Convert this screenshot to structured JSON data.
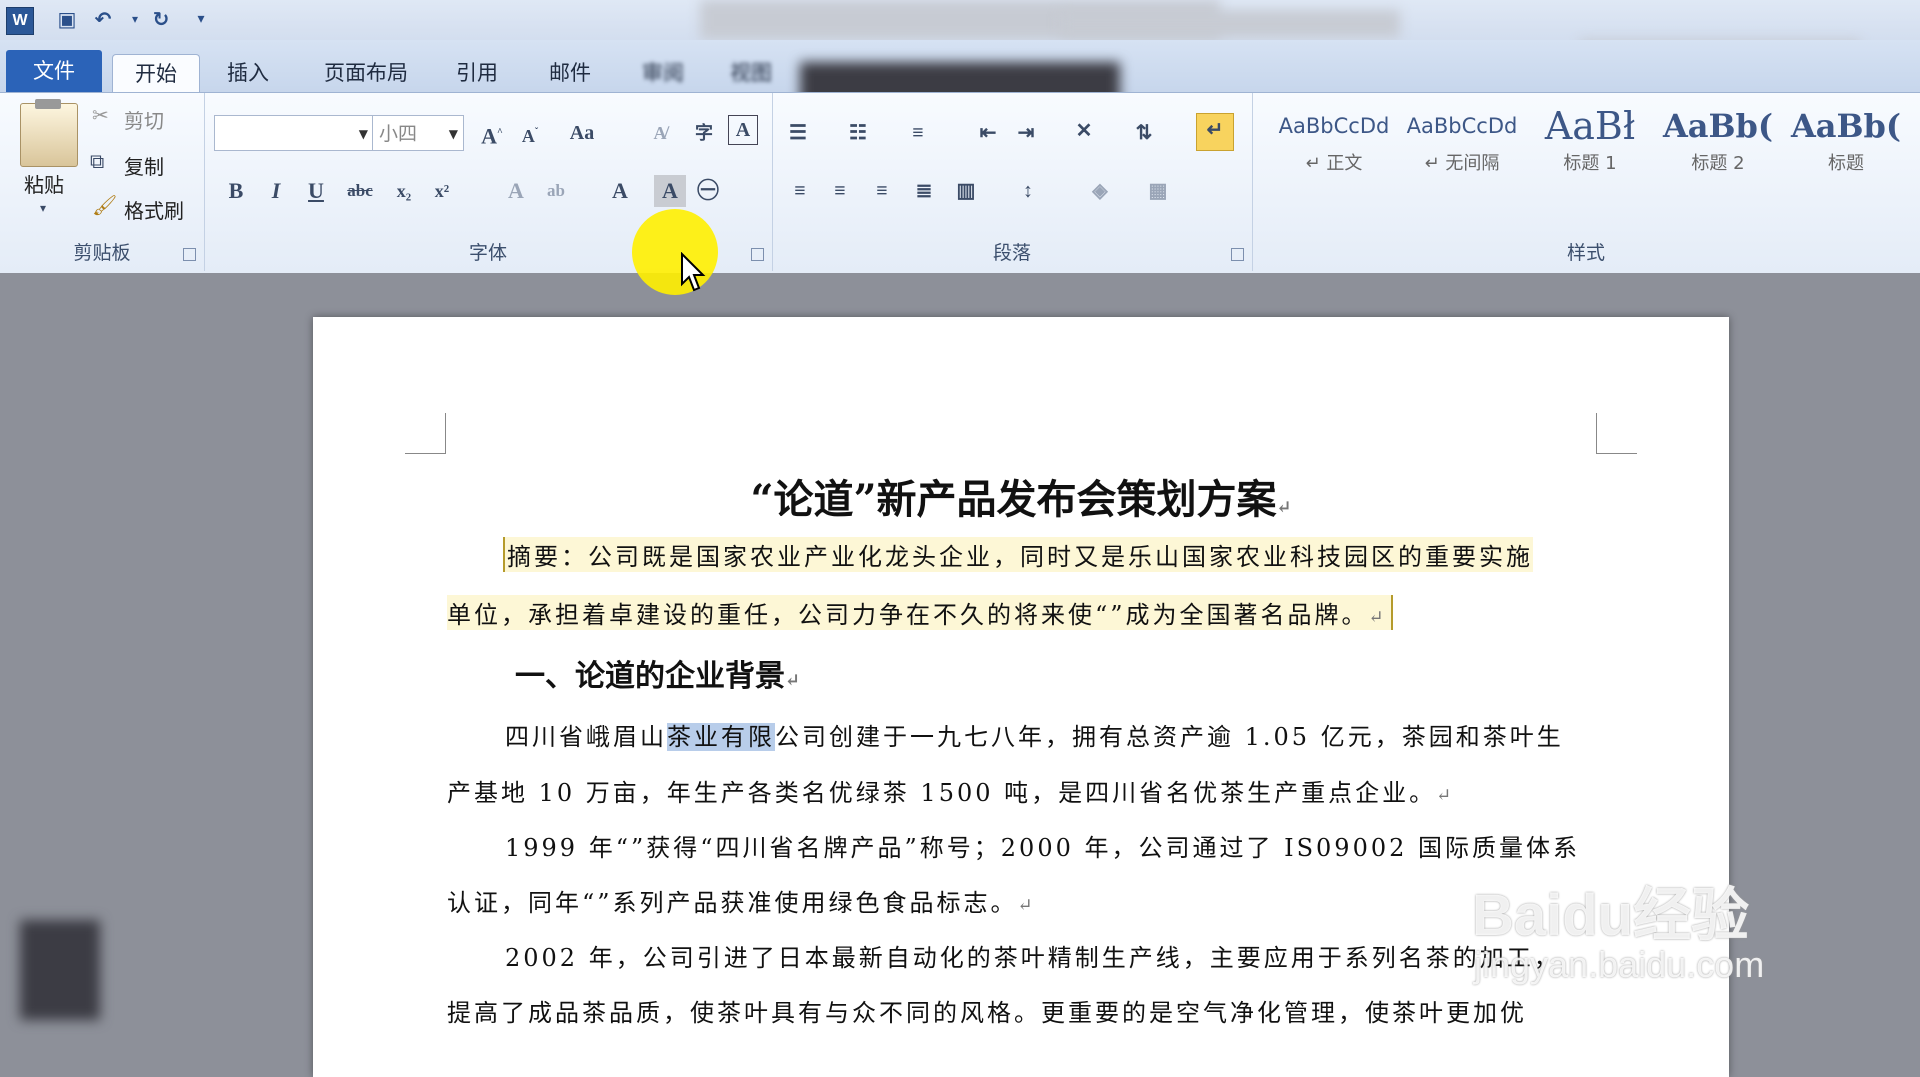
{
  "ribbon_tabs": {
    "file": "文件",
    "home": "开始",
    "insert": "插入",
    "layout": "页面布局",
    "references": "引用",
    "mailings": "邮件",
    "review": "审阅",
    "view": "视图"
  },
  "clipboard": {
    "paste": "粘贴",
    "cut": "剪切",
    "copy": "复制",
    "format_painter": "格式刷",
    "group": "剪贴板"
  },
  "font": {
    "size": "小四",
    "group": "字体"
  },
  "paragraph": {
    "group": "段落"
  },
  "styles": {
    "group": "样式",
    "items": [
      {
        "sample": "AaBbCcDd",
        "name": "↵ 正文"
      },
      {
        "sample": "AaBbCcDd",
        "name": "↵ 无间隔"
      },
      {
        "sample": "AaBł",
        "name": "标题 1"
      },
      {
        "sample": "AaBb(",
        "name": "标题 2"
      },
      {
        "sample": "AaBb(",
        "name": "标题"
      }
    ]
  },
  "document": {
    "title": "“论道”新产品发布会策划方案",
    "abstract_1": "摘要：公司既是国家农业产业化龙头企业，同时又是乐山国家农业科技园区的重要实施",
    "abstract_2": "单位，承担着卓建设的重任，公司力争在不久的将来使“”成为全国著名品牌。",
    "heading_1": "一、论道的企业背景",
    "p1_a": "四川省峨眉山",
    "p1_sel": "茶业有限",
    "p1_b": "公司创建于一九七八年，拥有总资产逾 1.05 亿元，茶园和茶叶生",
    "p1_2": "产基地 10 万亩，年生产各类名优绿茶 1500 吨，是四川省名优茶生产重点企业。",
    "p2_1": "1999 年“”获得“四川省名牌产品”称号；2000 年，公司通过了 IS09002 国际质量体系",
    "p2_2": "认证，同年“”系列产品获准使用绿色食品标志。",
    "p3_1": "2002  年，公司引进了日本最新自动化的茶叶精制生产线，主要应用于系列名茶的加工，",
    "p3_2": "提高了成品茶品质，使茶叶具有与众不同的风格。更重要的是空气净化管理，使茶叶更加优"
  },
  "watermark": {
    "brand": "Baidu经验",
    "url": "jingyan.baidu.com"
  }
}
